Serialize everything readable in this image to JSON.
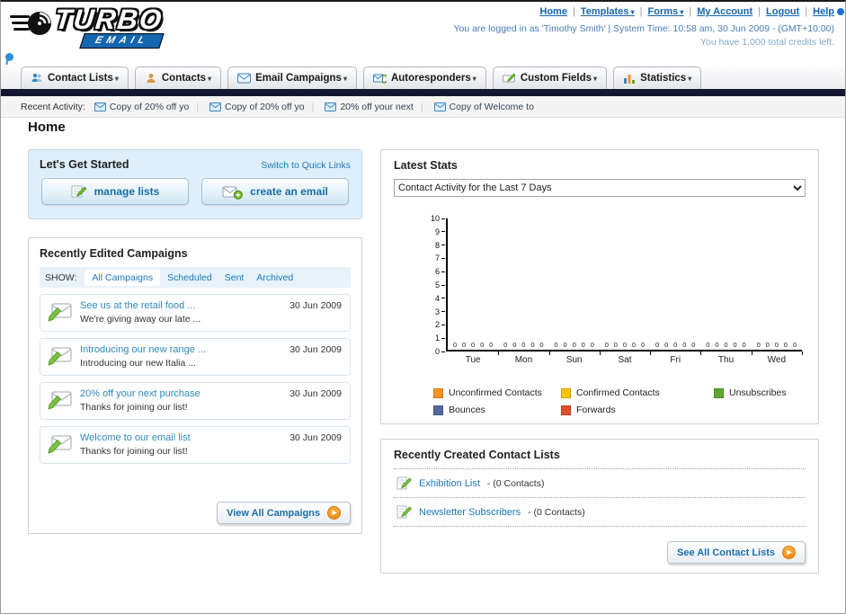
{
  "header": {
    "logo_title": "TURBO",
    "logo_subtitle": "EMAIL",
    "links": [
      {
        "label": "Home"
      },
      {
        "label": "Templates"
      },
      {
        "label": "Forms"
      },
      {
        "label": "My Account"
      },
      {
        "label": "Logout"
      },
      {
        "label": "Help"
      }
    ],
    "login_info": "You are logged in as 'Timothy Smith' | System Time: 10:58 am, 30 Jun 2009 - (GMT+10:00)",
    "credits_info": "You have 1,000 total credits left."
  },
  "nav_tabs": [
    {
      "label": "Contact Lists"
    },
    {
      "label": "Contacts"
    },
    {
      "label": "Email Campaigns"
    },
    {
      "label": "Autoresponders"
    },
    {
      "label": "Custom Fields"
    },
    {
      "label": "Statistics"
    }
  ],
  "recent_activity": {
    "label": "Recent Activity:",
    "items": [
      {
        "text": "Copy of 20% off yo"
      },
      {
        "text": "Copy of 20% off yo"
      },
      {
        "text": "20% off your next"
      },
      {
        "text": "Copy of Welcome to"
      }
    ]
  },
  "page": {
    "title": "Home"
  },
  "get_started": {
    "title": "Let's Get Started",
    "switch_link": "Switch to Quick Links",
    "manage_lists_label": "manage lists",
    "create_email_label": "create an email"
  },
  "campaigns": {
    "title": "Recently Edited Campaigns",
    "show_label": "SHOW:",
    "filters": [
      {
        "label": "All Campaigns"
      },
      {
        "label": "Scheduled"
      },
      {
        "label": "Sent"
      },
      {
        "label": "Archived"
      }
    ],
    "items": [
      {
        "title": "See us at the retail food ...",
        "subtitle": "We're giving away our late ...",
        "date": "30 Jun 2009"
      },
      {
        "title": "Introducing our new range ...",
        "subtitle": "Introducing our new Italia ...",
        "date": "30 Jun 2009"
      },
      {
        "title": "20% off your next purchase",
        "subtitle": "Thanks for joining our list!",
        "date": "30 Jun 2009"
      },
      {
        "title": "Welcome to our email list",
        "subtitle": "Thanks for joining our list!",
        "date": "30 Jun 2009"
      }
    ],
    "view_all_label": "View All Campaigns"
  },
  "stats": {
    "title": "Latest Stats",
    "selected_option": "Contact Activity for the Last 7 Days",
    "chart_data": {
      "type": "bar",
      "title": "Contact Activity for the Last 7 Days",
      "categories": [
        "Tue",
        "Mon",
        "Sun",
        "Sat",
        "Fri",
        "Thu",
        "Wed"
      ],
      "series": [
        {
          "name": "Unconfirmed Contacts",
          "color": "#f79420",
          "values": [
            0,
            0,
            0,
            0,
            0,
            0,
            0
          ]
        },
        {
          "name": "Confirmed Contacts",
          "color": "#fdc500",
          "values": [
            0,
            0,
            0,
            0,
            0,
            0,
            0
          ]
        },
        {
          "name": "Unsubscribes",
          "color": "#5ea632",
          "values": [
            0,
            0,
            0,
            0,
            0,
            0,
            0
          ]
        },
        {
          "name": "Bounces",
          "color": "#52689e",
          "values": [
            0,
            0,
            0,
            0,
            0,
            0,
            0
          ]
        },
        {
          "name": "Forwards",
          "color": "#e04e2a",
          "values": [
            0,
            0,
            0,
            0,
            0,
            0,
            0
          ]
        }
      ],
      "ylim": [
        0,
        10
      ],
      "grid": false,
      "legend_position": "bottom"
    }
  },
  "contact_lists": {
    "title": "Recently Created Contact Lists",
    "items": [
      {
        "name": "Exhibition List",
        "detail": "- (0 Contacts)"
      },
      {
        "name": "Newsletter Subscribers",
        "detail": "- (0 Contacts)"
      }
    ],
    "see_all_label": "See All Contact Lists"
  }
}
